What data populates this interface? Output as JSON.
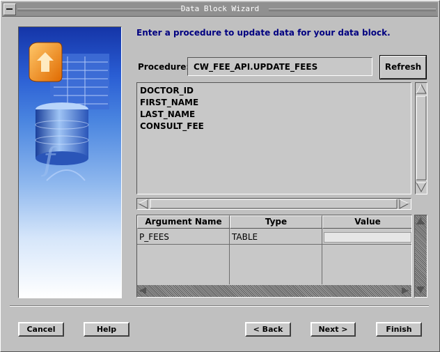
{
  "window": {
    "title": "Data Block Wizard"
  },
  "main": {
    "heading": "Enter a procedure to update data for your data block.",
    "procedure_label": "Procedure:",
    "procedure_value": "CW_FEE_API.UPDATE_FEES",
    "refresh_label": "Refresh",
    "columns_list": [
      "DOCTOR_ID",
      "FIRST_NAME",
      "LAST_NAME",
      "CONSULT_FEE"
    ]
  },
  "arguments": {
    "headers": [
      "Argument Name",
      "Type",
      "Value"
    ],
    "rows": [
      {
        "name": "P_FEES",
        "type": "TABLE",
        "value": ""
      }
    ]
  },
  "footer": {
    "cancel": "Cancel",
    "help": "Help",
    "back": "< Back",
    "next": "Next >",
    "finish": "Finish"
  },
  "colors": {
    "heading": "#000080",
    "background": "#c0c0c0",
    "titlebar": "#909090"
  },
  "icons": [
    "system-menu-icon",
    "scroll-up-arrow-icon",
    "scroll-down-arrow-icon",
    "scroll-left-arrow-icon",
    "scroll-right-arrow-icon",
    "forms-wizard-graphic"
  ]
}
